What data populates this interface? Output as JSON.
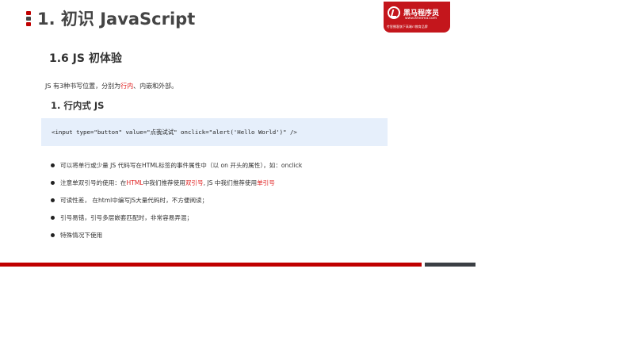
{
  "header": {
    "title": "1. 初识 JavaScript",
    "marker_colors": [
      "#c00000",
      "#444444",
      "#c00000"
    ]
  },
  "logo": {
    "name": "黑马程序员",
    "url": "www.itheima.com",
    "slogan": "传智播客旗下高端IT教育品牌",
    "color": "#c4161c"
  },
  "section": {
    "title": "1.6 JS 初体验",
    "intro": {
      "before": "JS 有3种书写位置，分别为",
      "highlight": "行内",
      "after": "、内嵌和外部。"
    },
    "subtitle": "1. 行内式 JS",
    "code": "<input type=\"button\" value=\"点我试试\" onclick=\"alert('Hello World')\" />"
  },
  "bullets": [
    {
      "parts": [
        {
          "text": "可以将单行或少量 JS 代码写在HTML标签的事件属性中（以 on 开头的属性），如：onclick",
          "red": false
        }
      ]
    },
    {
      "parts": [
        {
          "text": "注意单双引号的使用：在",
          "red": false
        },
        {
          "text": "HTML",
          "red": true
        },
        {
          "text": "中我们推荐使用",
          "red": false
        },
        {
          "text": "双引号",
          "red": true
        },
        {
          "text": ", JS 中我们推荐使用",
          "red": false
        },
        {
          "text": "单引号",
          "red": true
        }
      ]
    },
    {
      "parts": [
        {
          "text": "可读性差， 在html中编写JS大量代码时，不方便阅读；",
          "red": false
        }
      ]
    },
    {
      "parts": [
        {
          "text": "引号易错，引号多层嵌套匹配时，非常容易弄混；",
          "red": false
        }
      ]
    },
    {
      "parts": [
        {
          "text": "特殊情况下使用",
          "red": false
        }
      ]
    }
  ],
  "colors": {
    "accent_red": "#c00000",
    "highlight_red": "#e02020",
    "code_bg": "#e6effb",
    "footer_gray": "#3b3f44"
  }
}
